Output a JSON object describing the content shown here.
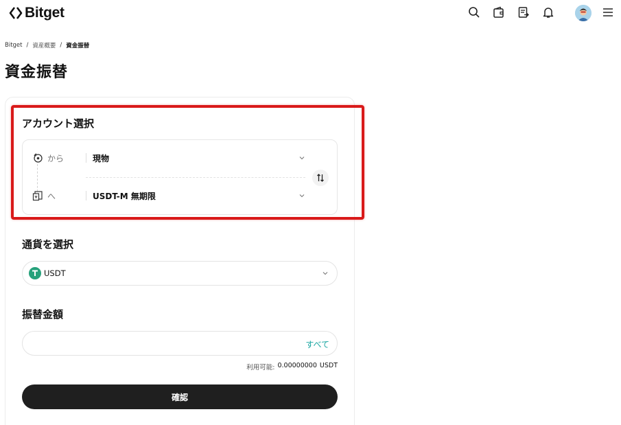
{
  "header": {
    "logo_text": "Bitget",
    "icons": [
      "search-icon",
      "wallet-icon",
      "orders-icon",
      "bell-icon",
      "avatar",
      "menu-icon"
    ]
  },
  "breadcrumb": [
    "Bitget",
    "資産概要",
    "資金振替"
  ],
  "page_title": "資金振替",
  "account_section": {
    "title": "アカウント選択",
    "from_label": "から",
    "from_value": "現物",
    "to_label": "へ",
    "to_value": "USDT-M 無期限"
  },
  "currency_section": {
    "title": "通貨を選択",
    "selected": "USDT"
  },
  "amount_section": {
    "title": "振替金額",
    "input_value": "",
    "max_label": "すべて",
    "available_label": "利用可能:",
    "available_value": "0.00000000",
    "available_unit": "USDT"
  },
  "confirm_label": "確認",
  "colors": {
    "accent": "#1aa6a1",
    "highlight": "#d91a1a",
    "button_bg": "#1f1f1f",
    "tether": "#26a17b"
  }
}
